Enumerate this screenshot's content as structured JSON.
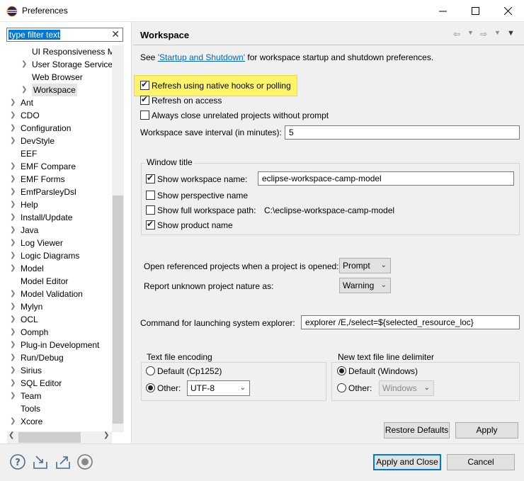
{
  "window": {
    "title": "Preferences",
    "min": "—",
    "max": "☐",
    "close": "✕"
  },
  "filter": {
    "text": "type filter text",
    "clear": "✕"
  },
  "tree": [
    {
      "label": "UI Responsiveness Monitoring",
      "indent": 1,
      "chevron": ""
    },
    {
      "label": "User Storage Service",
      "indent": 1,
      "chevron": ">"
    },
    {
      "label": "Web Browser",
      "indent": 1,
      "chevron": ""
    },
    {
      "label": "Workspace",
      "indent": 1,
      "chevron": ">",
      "selected": true
    },
    {
      "label": "Ant",
      "indent": 0,
      "chevron": ">"
    },
    {
      "label": "CDO",
      "indent": 0,
      "chevron": ">"
    },
    {
      "label": "Configuration",
      "indent": 0,
      "chevron": ">"
    },
    {
      "label": "DevStyle",
      "indent": 0,
      "chevron": ">"
    },
    {
      "label": "EEF",
      "indent": 0,
      "chevron": ""
    },
    {
      "label": "EMF Compare",
      "indent": 0,
      "chevron": ">"
    },
    {
      "label": "EMF Forms",
      "indent": 0,
      "chevron": ">"
    },
    {
      "label": "EmfParsleyDsl",
      "indent": 0,
      "chevron": ">"
    },
    {
      "label": "Help",
      "indent": 0,
      "chevron": ">"
    },
    {
      "label": "Install/Update",
      "indent": 0,
      "chevron": ">"
    },
    {
      "label": "Java",
      "indent": 0,
      "chevron": ">"
    },
    {
      "label": "Log Viewer",
      "indent": 0,
      "chevron": ">"
    },
    {
      "label": "Logic Diagrams",
      "indent": 0,
      "chevron": ">"
    },
    {
      "label": "Model",
      "indent": 0,
      "chevron": ">"
    },
    {
      "label": "Model Editor",
      "indent": 0,
      "chevron": ""
    },
    {
      "label": "Model Validation",
      "indent": 0,
      "chevron": ">"
    },
    {
      "label": "Mylyn",
      "indent": 0,
      "chevron": ">"
    },
    {
      "label": "OCL",
      "indent": 0,
      "chevron": ">"
    },
    {
      "label": "Oomph",
      "indent": 0,
      "chevron": ">"
    },
    {
      "label": "Plug-in Development",
      "indent": 0,
      "chevron": ">"
    },
    {
      "label": "Run/Debug",
      "indent": 0,
      "chevron": ">"
    },
    {
      "label": "Sirius",
      "indent": 0,
      "chevron": ">"
    },
    {
      "label": "SQL Editor",
      "indent": 0,
      "chevron": ">"
    },
    {
      "label": "Team",
      "indent": 0,
      "chevron": ">"
    },
    {
      "label": "Tools",
      "indent": 0,
      "chevron": ""
    },
    {
      "label": "Xcore",
      "indent": 0,
      "chevron": ">"
    }
  ],
  "page": {
    "title": "Workspace",
    "see_prefix": "See ",
    "see_link": "'Startup and Shutdown'",
    "see_suffix": " for workspace startup and shutdown preferences.",
    "refresh_native": {
      "label": "Refresh using native hooks or polling",
      "checked": true
    },
    "refresh_access": {
      "label": "Refresh on access",
      "checked": true
    },
    "always_close": {
      "label": "Always close unrelated projects without prompt",
      "checked": false
    },
    "save_interval_label": "Workspace save interval (in minutes):",
    "save_interval_value": "5",
    "window_title": {
      "group_label": "Window title",
      "show_ws_name": {
        "label": "Show workspace name:",
        "checked": true,
        "value": "eclipse-workspace-camp-model"
      },
      "show_perspective": {
        "label": "Show perspective name",
        "checked": false
      },
      "show_full_path": {
        "label": "Show full workspace path:",
        "checked": false,
        "value": "C:\\eclipse-workspace-camp-model"
      },
      "show_product": {
        "label": "Show product name",
        "checked": true
      }
    },
    "open_ref_label": "Open referenced projects when a project is opened:",
    "open_ref_value": "Prompt",
    "report_nature_label": "Report unknown project nature as:",
    "report_nature_value": "Warning",
    "sys_explorer_label": "Command for launching system explorer:",
    "sys_explorer_value": "explorer /E,/select=${selected_resource_loc}",
    "encoding": {
      "group_label": "Text file encoding",
      "default_label": "Default (Cp1252)",
      "other_label": "Other:",
      "other_value": "UTF-8",
      "selected": "other"
    },
    "delimiter": {
      "group_label": "New text file line delimiter",
      "default_label": "Default (Windows)",
      "other_label": "Other:",
      "other_value": "Windows",
      "selected": "default"
    },
    "restore_defaults": "Restore Defaults",
    "apply": "Apply"
  },
  "footer": {
    "apply_close": "Apply and Close",
    "cancel": "Cancel",
    "icons": [
      "help-icon",
      "import-icon",
      "export-icon",
      "record-icon"
    ]
  },
  "colors": {
    "highlight": "#fdf46a",
    "selection": "#0078d7",
    "link": "#0066cc"
  }
}
